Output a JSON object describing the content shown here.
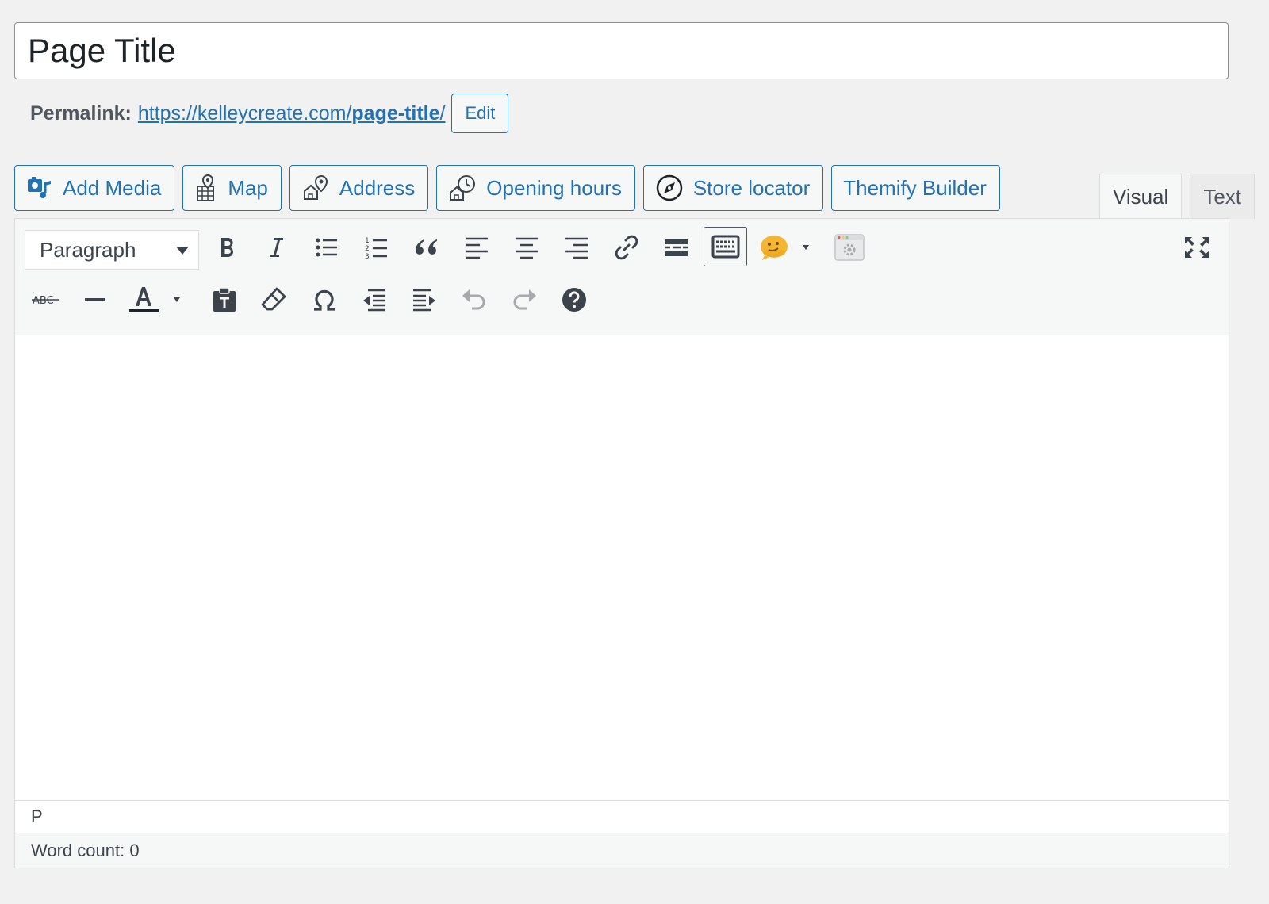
{
  "title": {
    "value": "Page Title"
  },
  "permalink": {
    "label": "Permalink:",
    "url_base": "https://kelleycreate.com/",
    "url_slug": "page-title",
    "url_trail": "/",
    "edit_label": "Edit"
  },
  "media_buttons": [
    {
      "label": "Add Media",
      "icon": "add-media-icon"
    },
    {
      "label": "Map",
      "icon": "map-icon"
    },
    {
      "label": "Address",
      "icon": "address-icon"
    },
    {
      "label": "Opening hours",
      "icon": "opening-hours-icon"
    },
    {
      "label": "Store locator",
      "icon": "compass-icon"
    },
    {
      "label": "Themify Builder",
      "icon": ""
    }
  ],
  "tabs": {
    "visual": "Visual",
    "text": "Text",
    "active": "Visual"
  },
  "toolbar": {
    "format_select": "Paragraph",
    "row1_icons": [
      "bold-icon",
      "italic-icon",
      "bullet-list-icon",
      "numbered-list-icon",
      "blockquote-icon",
      "align-left-icon",
      "align-center-icon",
      "align-right-icon",
      "link-icon",
      "read-more-icon",
      "toolbar-toggle-icon",
      "emoji-icon",
      "settings-icon",
      "fullscreen-icon"
    ],
    "row2_icons": [
      "strikethrough-icon",
      "horizontal-line-icon",
      "text-color-icon",
      "paste-text-icon",
      "clear-formatting-icon",
      "special-character-icon",
      "outdent-icon",
      "indent-icon",
      "undo-icon",
      "redo-icon",
      "help-icon"
    ],
    "text_color": "#1d2327"
  },
  "path": "P",
  "word_count": "Word count: 0",
  "colors": {
    "accent": "#2271b1",
    "icon": "#3c434a",
    "disabled": "#a7aaad",
    "background": "#f1f1f1"
  }
}
